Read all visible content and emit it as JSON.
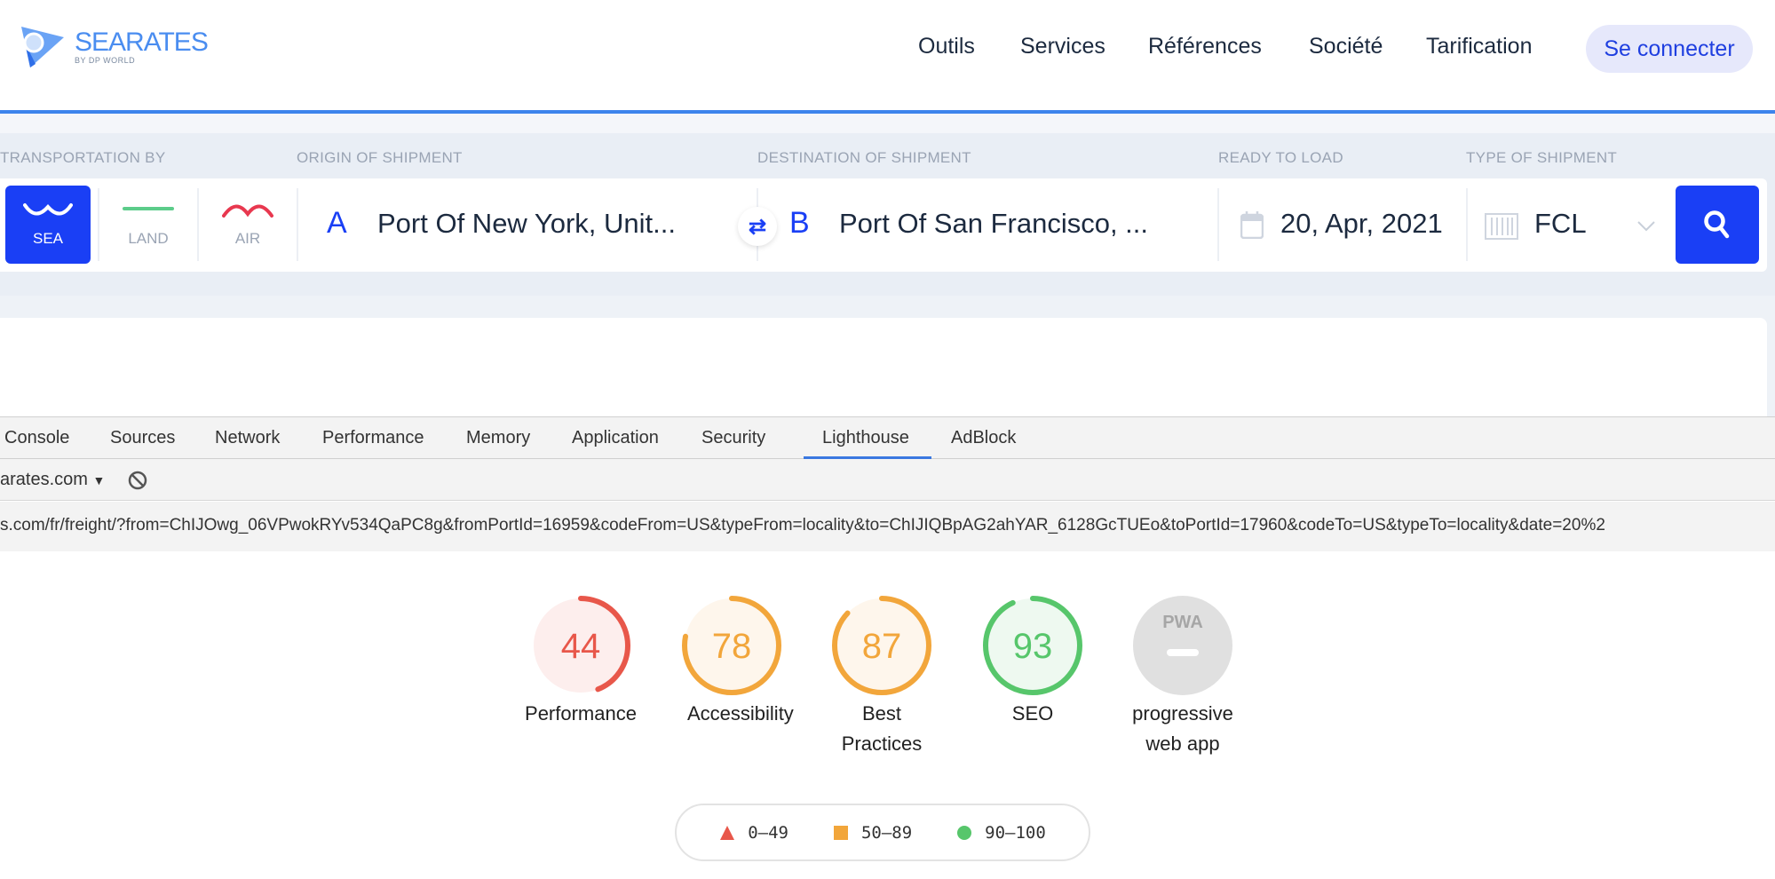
{
  "header": {
    "logo": {
      "name": "SEARATES",
      "sub": "BY DP WORLD"
    },
    "nav": [
      "Outils",
      "Services",
      "Références",
      "Société",
      "Tarification"
    ],
    "login": "Se connecter"
  },
  "search": {
    "labels": {
      "transport": "TRANSPORTATION BY",
      "origin": "ORIGIN OF SHIPMENT",
      "destination": "DESTINATION OF SHIPMENT",
      "ready": "READY TO LOAD",
      "type": "TYPE OF SHIPMENT"
    },
    "modes": [
      {
        "label": "SEA",
        "icon": "wave-icon",
        "active": true
      },
      {
        "label": "LAND",
        "icon": "road-icon"
      },
      {
        "label": "AIR",
        "icon": "flight-arc-icon"
      }
    ],
    "origin": {
      "letter": "A",
      "value": "Port Of New York, Unit..."
    },
    "destination": {
      "letter": "B",
      "value": "Port Of San Francisco, ..."
    },
    "date": "20, Apr, 2021",
    "type": "FCL",
    "accent": "#1a3ff5"
  },
  "devtools": {
    "tabs": [
      "Console",
      "Sources",
      "Network",
      "Performance",
      "Memory",
      "Application",
      "Security",
      "Lighthouse",
      "AdBlock"
    ],
    "active_tab": "Lighthouse",
    "context": "arates.com",
    "url": "s.com/fr/freight/?from=ChIJOwg_06VPwokRYv534QaPC8g&fromPortId=16959&codeFrom=US&typeFrom=locality&to=ChIJIQBpAG2ahYAR_6128GcTUEo&toPortId=17960&codeTo=US&typeTo=locality&date=20%2"
  },
  "lighthouse": {
    "scores": [
      {
        "label": "Performance",
        "value": 44,
        "color": "#e8574a",
        "bg": "#fdeeed"
      },
      {
        "label": "Accessibility",
        "value": 78,
        "color": "#f2a63b",
        "bg": "#fef6ec"
      },
      {
        "label": "Best Practices",
        "value": 87,
        "color": "#f2a63b",
        "bg": "#fef6ec"
      },
      {
        "label": "SEO",
        "value": 93,
        "color": "#57c66b",
        "bg": "#eef9f0"
      }
    ],
    "pwa": {
      "label": "progressive web app",
      "badge": "PWA"
    },
    "legend": [
      {
        "range": "0–49",
        "shape": "triangle",
        "color": "#e8574a"
      },
      {
        "range": "50–89",
        "shape": "square",
        "color": "#f2a63b"
      },
      {
        "range": "90–100",
        "shape": "circle",
        "color": "#57c66b"
      }
    ]
  }
}
